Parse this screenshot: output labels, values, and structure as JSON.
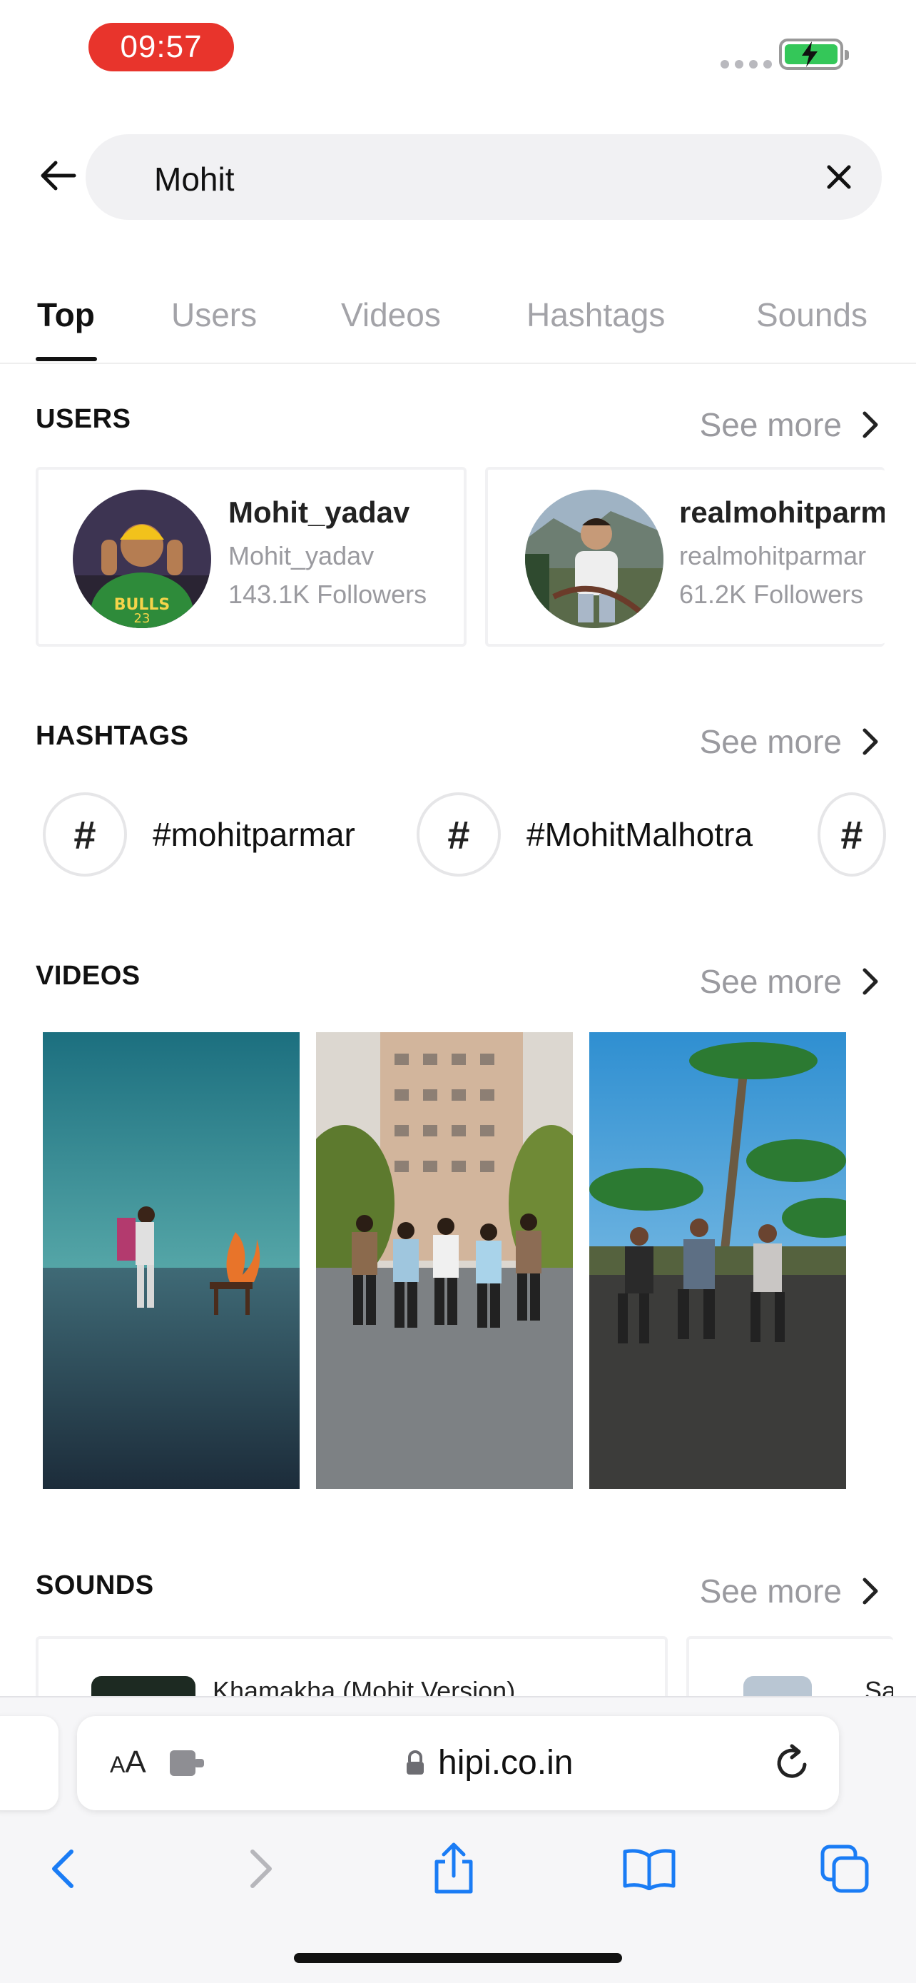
{
  "status_bar": {
    "time": "09:57",
    "battery_color": "#34c759",
    "time_pill_color": "#e8342c"
  },
  "search": {
    "query": "Mohit",
    "back_icon": "arrow-left-icon",
    "clear_icon": "close-icon"
  },
  "tabs": [
    {
      "label": "Top",
      "active": true
    },
    {
      "label": "Users",
      "active": false
    },
    {
      "label": "Videos",
      "active": false
    },
    {
      "label": "Hashtags",
      "active": false
    },
    {
      "label": "Sounds",
      "active": false
    }
  ],
  "users_section": {
    "title": "USERS",
    "see_more": "See more",
    "users": [
      {
        "name": "Mohit_yadav",
        "handle": "Mohit_yadav",
        "followers": "143.1K Followers"
      },
      {
        "name": "realmohitparmar",
        "handle": "realmohitparmar",
        "followers": "61.2K Followers"
      }
    ]
  },
  "hashtags_section": {
    "title": "HASHTAGS",
    "see_more": "See more",
    "items": [
      {
        "symbol": "#",
        "label": "#mohitparmar"
      },
      {
        "symbol": "#",
        "label": "#MohitMalhotra"
      },
      {
        "symbol": "#",
        "label": ""
      }
    ]
  },
  "videos_section": {
    "title": "VIDEOS",
    "see_more": "See more",
    "count_visible": 3
  },
  "sounds_section": {
    "title": "SOUNDS",
    "see_more": "See more",
    "items": [
      {
        "title": "Khamakha (Mohit Version)"
      },
      {
        "title": "Sa"
      }
    ]
  },
  "browser": {
    "text_size_label_small": "A",
    "text_size_label_large": "A",
    "url": "hipi.co.in",
    "accent": "#1a7cf5"
  }
}
